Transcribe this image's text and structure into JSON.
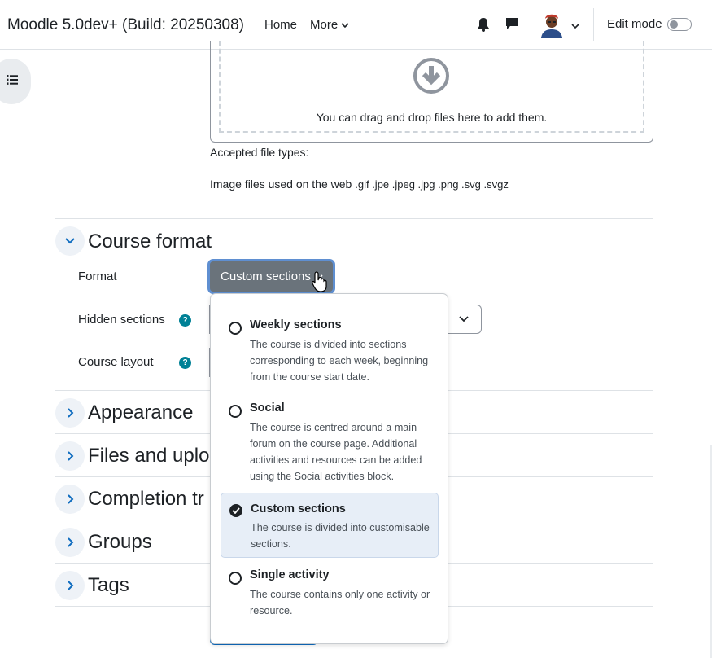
{
  "navbar": {
    "brand": "Moodle 5.0dev+ (Build: 20250308)",
    "home": "Home",
    "more": "More",
    "edit_mode": "Edit mode",
    "edit_mode_on": false
  },
  "filepicker": {
    "drop_text": "You can drag and drop files here to add them.",
    "accepted_label": "Accepted file types:",
    "types_label": "Image files used on the web",
    "types_exts": ".gif .jpe .jpeg .jpg .png .svg .svgz"
  },
  "sections": {
    "course_format": "Course format",
    "appearance": "Appearance",
    "files": "Files and uplo",
    "completion": "Completion tr",
    "groups": "Groups",
    "tags": "Tags"
  },
  "form": {
    "format_label": "Format",
    "format_value": "Custom sections",
    "hidden_label": "Hidden sections",
    "layout_label": "Course layout",
    "help": "?"
  },
  "dropdown": {
    "options": [
      {
        "title": "Weekly sections",
        "desc": "The course is divided into sections corresponding to each week, beginning from the course start date.",
        "selected": false
      },
      {
        "title": "Social",
        "desc": "The course is centred around a main forum on the course page. Additional activities and resources can be added using the Social activities block.",
        "selected": false
      },
      {
        "title": "Custom sections",
        "desc": "The course is divided into customisable sections.",
        "selected": true
      },
      {
        "title": "Single activity",
        "desc": "The course contains only one activity or resource.",
        "selected": false
      }
    ]
  },
  "colors": {
    "accent": "#0f6cbf",
    "help_badge": "#008196",
    "format_button": "#6a737b",
    "selected_option_bg": "#e7eef7"
  },
  "icons": [
    "bell-icon",
    "chat-icon",
    "chevron-down-icon",
    "chevron-right-icon",
    "download-circle-icon",
    "list-icon",
    "check-icon",
    "hand-cursor-icon"
  ]
}
